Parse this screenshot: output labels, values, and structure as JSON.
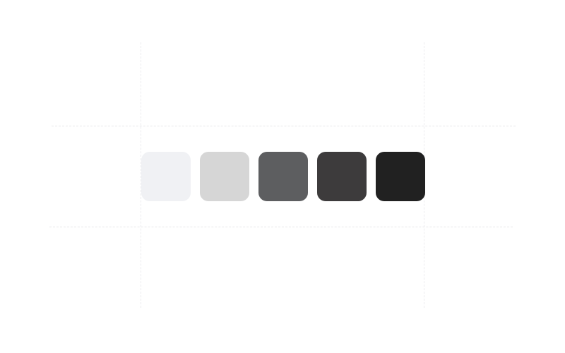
{
  "palette": {
    "swatches": [
      {
        "color": "#f0f1f4"
      },
      {
        "color": "#d6d6d6"
      },
      {
        "color": "#5d5e60"
      },
      {
        "color": "#3d3b3c"
      },
      {
        "color": "#212121"
      }
    ]
  }
}
